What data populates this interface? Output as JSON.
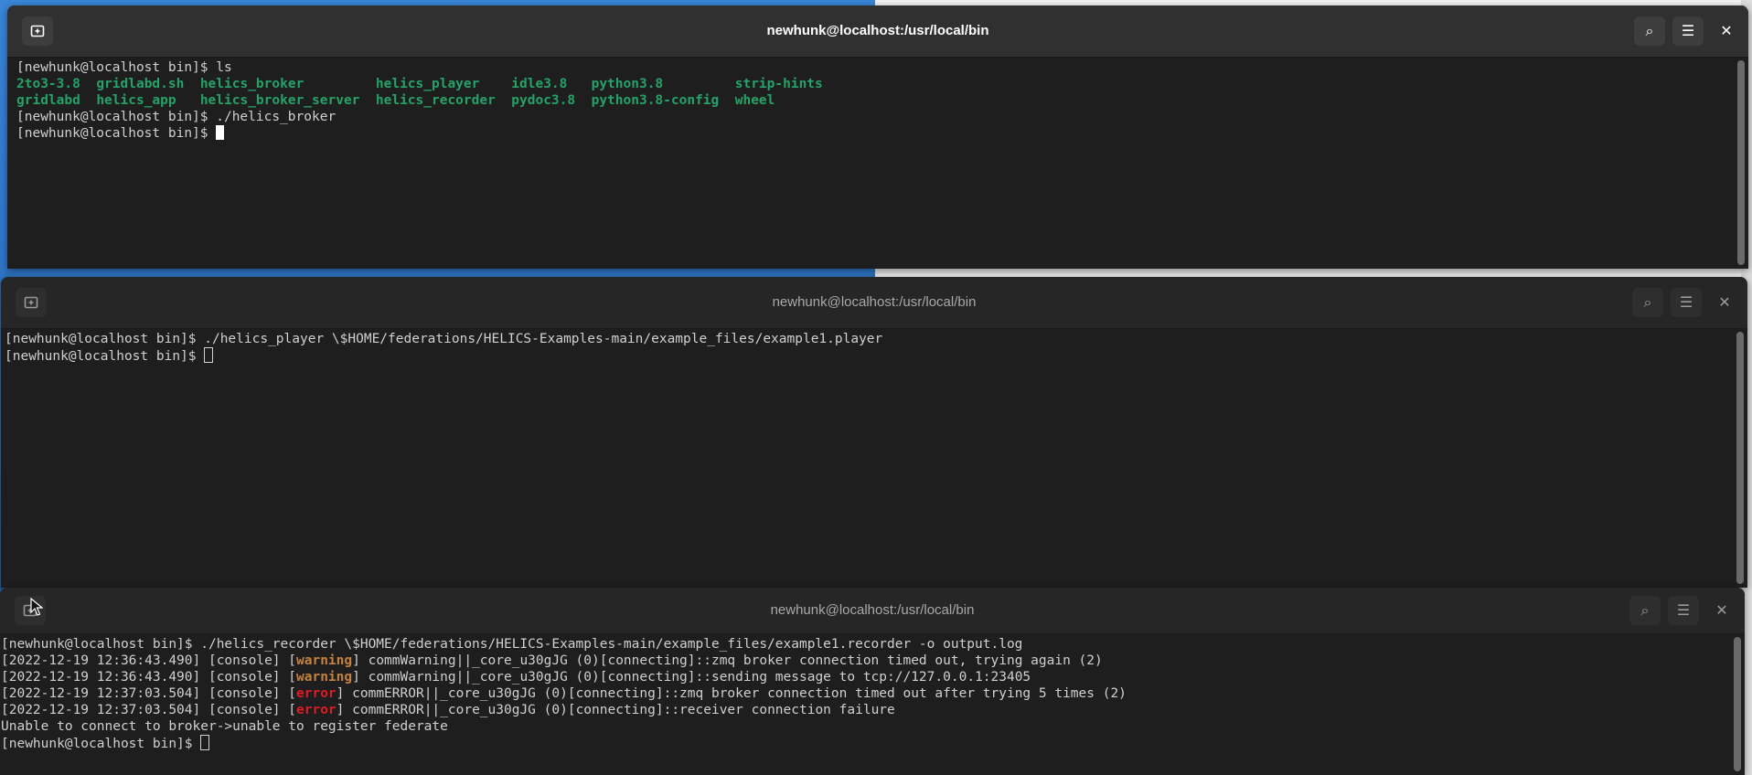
{
  "windows": [
    {
      "title": "newhunk@localhost:/usr/local/bin",
      "lines": [
        {
          "segments": [
            {
              "text": "[newhunk@localhost bin]$ ls",
              "style": "plain"
            }
          ]
        },
        {
          "segments": [
            {
              "text": "2to3-3.8  ",
              "style": "green"
            },
            {
              "text": "gridlabd.sh  ",
              "style": "green"
            },
            {
              "text": "helics_broker         ",
              "style": "green"
            },
            {
              "text": "helics_player    ",
              "style": "green"
            },
            {
              "text": "idle3.8   ",
              "style": "green"
            },
            {
              "text": "python3.8         ",
              "style": "green"
            },
            {
              "text": "strip-hints",
              "style": "green"
            }
          ]
        },
        {
          "segments": [
            {
              "text": "gridlabd  ",
              "style": "green"
            },
            {
              "text": "helics_app   ",
              "style": "green"
            },
            {
              "text": "helics_broker_server  ",
              "style": "green"
            },
            {
              "text": "helics_recorder  ",
              "style": "green"
            },
            {
              "text": "pydoc3.8  ",
              "style": "green"
            },
            {
              "text": "python3.8-config  ",
              "style": "green"
            },
            {
              "text": "wheel",
              "style": "green"
            }
          ]
        },
        {
          "segments": [
            {
              "text": "[newhunk@localhost bin]$ ./helics_broker",
              "style": "plain"
            }
          ]
        },
        {
          "segments": [
            {
              "text": "[newhunk@localhost bin]$ ",
              "style": "plain"
            }
          ],
          "cursor": "block"
        }
      ]
    },
    {
      "title": "newhunk@localhost:/usr/local/bin",
      "lines": [
        {
          "segments": [
            {
              "text": "[newhunk@localhost bin]$ ./helics_player \\$HOME/federations/HELICS-Examples-main/example_files/example1.player",
              "style": "plain"
            }
          ]
        },
        {
          "segments": [
            {
              "text": "[newhunk@localhost bin]$ ",
              "style": "plain"
            }
          ],
          "cursor": "hollow"
        }
      ]
    },
    {
      "title": "newhunk@localhost:/usr/local/bin",
      "lines": [
        {
          "segments": [
            {
              "text": "[newhunk@localhost bin]$ ./helics_recorder \\$HOME/federations/HELICS-Examples-main/example_files/example1.recorder -o output.log",
              "style": "plain"
            }
          ]
        },
        {
          "segments": [
            {
              "text": "[2022-12-19 12:36:43.490] [console] [",
              "style": "plain"
            },
            {
              "text": "warning",
              "style": "warn"
            },
            {
              "text": "] commWarning||_core_u30gJG (0)[connecting]::zmq broker connection timed out, trying again (2)",
              "style": "plain"
            }
          ]
        },
        {
          "segments": [
            {
              "text": "[2022-12-19 12:36:43.490] [console] [",
              "style": "plain"
            },
            {
              "text": "warning",
              "style": "warn"
            },
            {
              "text": "] commWarning||_core_u30gJG (0)[connecting]::sending message to tcp://127.0.0.1:23405",
              "style": "plain"
            }
          ]
        },
        {
          "segments": [
            {
              "text": "[2022-12-19 12:37:03.504] [console] [",
              "style": "plain"
            },
            {
              "text": "error",
              "style": "err"
            },
            {
              "text": "] commERROR||_core_u30gJG (0)[connecting]::zmq broker connection timed out after trying 5 times (2)",
              "style": "plain"
            }
          ]
        },
        {
          "segments": [
            {
              "text": "[2022-12-19 12:37:03.504] [console] [",
              "style": "plain"
            },
            {
              "text": "error",
              "style": "err"
            },
            {
              "text": "] commERROR||_core_u30gJG (0)[connecting]::receiver connection failure",
              "style": "plain"
            }
          ]
        },
        {
          "segments": [
            {
              "text": "Unable to connect to broker->unable to register federate",
              "style": "plain"
            }
          ]
        },
        {
          "segments": [
            {
              "text": "[newhunk@localhost bin]$ ",
              "style": "plain"
            }
          ],
          "cursor": "hollow"
        }
      ]
    }
  ],
  "icons": {
    "new_tab": "new-tab-icon",
    "search": "search-icon",
    "menu": "hamburger-menu-icon",
    "close": "close-icon",
    "pointer": "mouse-pointer-icon"
  },
  "glyphs": {
    "search": "⌕",
    "menu": "☰",
    "close": "✕"
  },
  "colors": {
    "terminal_bg": "#1e1e1e",
    "titlebar_active": "#303030",
    "titlebar_inactive": "#262626",
    "exec_green": "#26a269",
    "warning": "#c5813e",
    "error": "#e01b24",
    "text": "#d0d0d0"
  }
}
